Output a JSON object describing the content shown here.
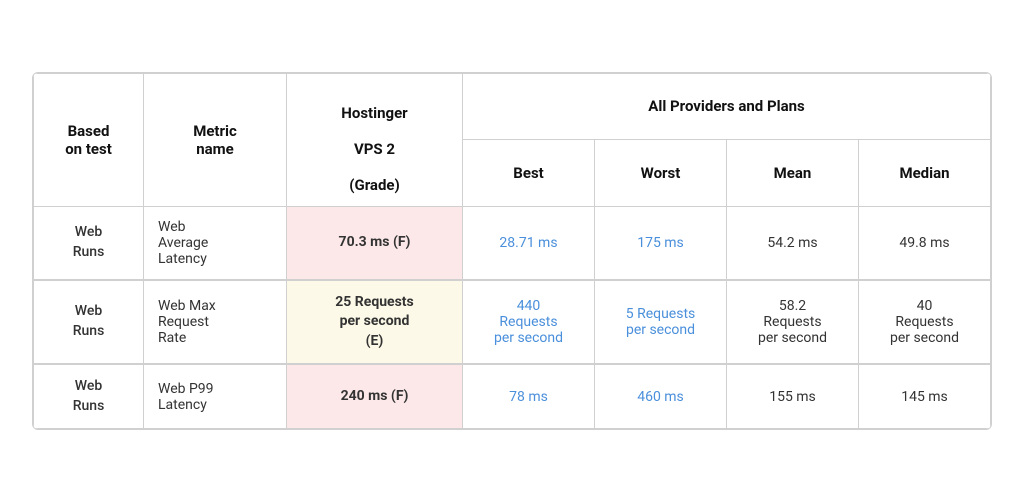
{
  "table": {
    "header": {
      "col1": "Based\non test",
      "col2": "Metric\nname",
      "col3_line1": "Hostinger",
      "col3_line2": "VPS 2",
      "col3_line3": "(Grade)",
      "all_providers": "All Providers and Plans",
      "best": "Best",
      "worst": "Worst",
      "mean": "Mean",
      "median": "Median"
    },
    "rows": [
      {
        "based_on_test": "Web\nRuns",
        "metric_name": "Web\nAverage\nLatency",
        "hostinger_value": "70.3 ms (F)",
        "hostinger_grade": "F",
        "best": "28.71 ms",
        "worst": "175 ms",
        "mean": "54.2 ms",
        "median": "49.8 ms",
        "hostinger_class": "cell-hostinger-f"
      },
      {
        "based_on_test": "Web\nRuns",
        "metric_name": "Web Max\nRequest\nRate",
        "hostinger_value": "25 Requests\nper second\n(E)",
        "hostinger_grade": "E",
        "best": "440\nRequests\nper second",
        "worst": "5 Requests\nper second",
        "mean": "58.2\nRequests\nper second",
        "median": "40\nRequests\nper second",
        "hostinger_class": "cell-hostinger-e"
      },
      {
        "based_on_test": "Web\nRuns",
        "metric_name": "Web P99\nLatency",
        "hostinger_value": "240 ms (F)",
        "hostinger_grade": "F",
        "best": "78 ms",
        "worst": "460 ms",
        "mean": "155 ms",
        "median": "145 ms",
        "hostinger_class": "cell-hostinger-f"
      }
    ]
  }
}
